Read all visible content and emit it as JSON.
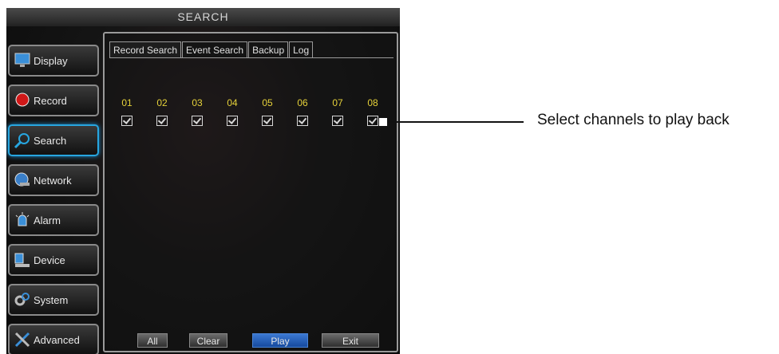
{
  "window": {
    "title": "SEARCH"
  },
  "sidebar": {
    "items": [
      {
        "label": "Display",
        "icon": "monitor-icon"
      },
      {
        "label": "Record",
        "icon": "record-icon"
      },
      {
        "label": "Search",
        "icon": "magnifier-icon",
        "active": true
      },
      {
        "label": "Network",
        "icon": "globe-network-icon"
      },
      {
        "label": "Alarm",
        "icon": "alarm-siren-icon"
      },
      {
        "label": "Device",
        "icon": "device-icon"
      },
      {
        "label": "System",
        "icon": "gears-icon"
      },
      {
        "label": "Advanced",
        "icon": "tools-icon"
      }
    ]
  },
  "tabs": [
    "Record Search",
    "Event Search",
    "Backup",
    "Log"
  ],
  "channels": [
    "01",
    "02",
    "03",
    "04",
    "05",
    "06",
    "07",
    "08"
  ],
  "buttons": {
    "all": "All",
    "clear": "Clear",
    "play": "Play",
    "exit": "Exit"
  },
  "callout": {
    "text": "Select channels to play back"
  },
  "colors": {
    "active_accent": "#27a6e0",
    "channel_number": "#e6d23a",
    "play_button": "#2d64bd"
  }
}
